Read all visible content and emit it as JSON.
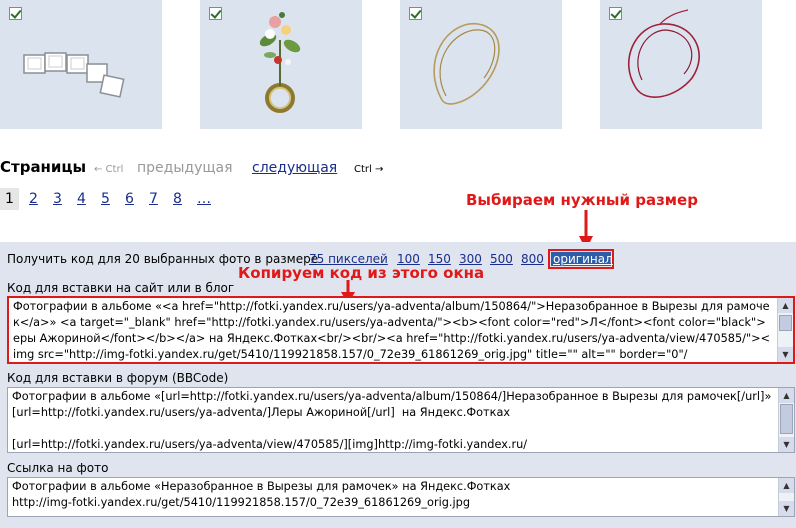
{
  "thumbnails": [
    {
      "name": "photo-frames-chain",
      "checked": true
    },
    {
      "name": "photo-flower-ring",
      "checked": true
    },
    {
      "name": "photo-gold-loop",
      "checked": true
    },
    {
      "name": "photo-red-loop",
      "checked": true
    }
  ],
  "pager": {
    "title": "Страницы",
    "ctrl_prev": "← Ctrl",
    "prev_label": "предыдущая",
    "next_label": "следующая",
    "ctrl_next": "Ctrl →",
    "pages": [
      "1",
      "2",
      "3",
      "4",
      "5",
      "6",
      "7",
      "8",
      "…"
    ],
    "current_page": "1"
  },
  "annotations": {
    "choose_size": "Выбираем нужный размер",
    "copy_code": "Копируем код из этого окна",
    "color": "#e01818"
  },
  "size_bar": {
    "prefix": "Получить код для 20 выбранных фото в размере",
    "sizes": [
      "75 пикселей",
      "100",
      "150",
      "300",
      "500",
      "800"
    ],
    "selected": "оригинал"
  },
  "code_blog": {
    "label": "Код для вставки на сайт или в блог",
    "value": "Фотографии в альбоме «<a href=\"http://fotki.yandex.ru/users/ya-adventa/album/150864/\">Неразобранное в Вырезы для рамочек</a>» <a target=\"_blank\" href=\"http://fotki.yandex.ru/users/ya-adventa/\"><b><font color=\"red\">Л</font><font color=\"black\">еры Ажориной</font></b></a> на Яндекс.Фотках<br/><br/><a href=\"http://fotki.yandex.ru/users/ya-adventa/view/470585/\"><img src=\"http://img-fotki.yandex.ru/get/5410/119921858.157/0_72e39_61861269_orig.jpg\" title=\"\" alt=\"\" border=\"0\"/"
  },
  "code_forum": {
    "label": "Код для вставки в форум (BBCode)",
    "value": "Фотографии в альбоме «[url=http://fotki.yandex.ru/users/ya-adventa/album/150864/]Неразобранное в Вырезы для рамочек[/url]» [url=http://fotki.yandex.ru/users/ya-adventa/]Леры Ажориной[/url]  на Яндекс.Фотках\n\n[url=http://fotki.yandex.ru/users/ya-adventa/view/470585/][img]http://img-fotki.yandex.ru/"
  },
  "photo_link": {
    "label": "Ссылка на фото",
    "value": "Фотографии в альбоме «Неразобранное в Вырезы для рамочек» на Яндекс.Фотках\nhttp://img-fotki.yandex.ru/get/5410/119921858.157/0_72e39_61861269_orig.jpg"
  }
}
